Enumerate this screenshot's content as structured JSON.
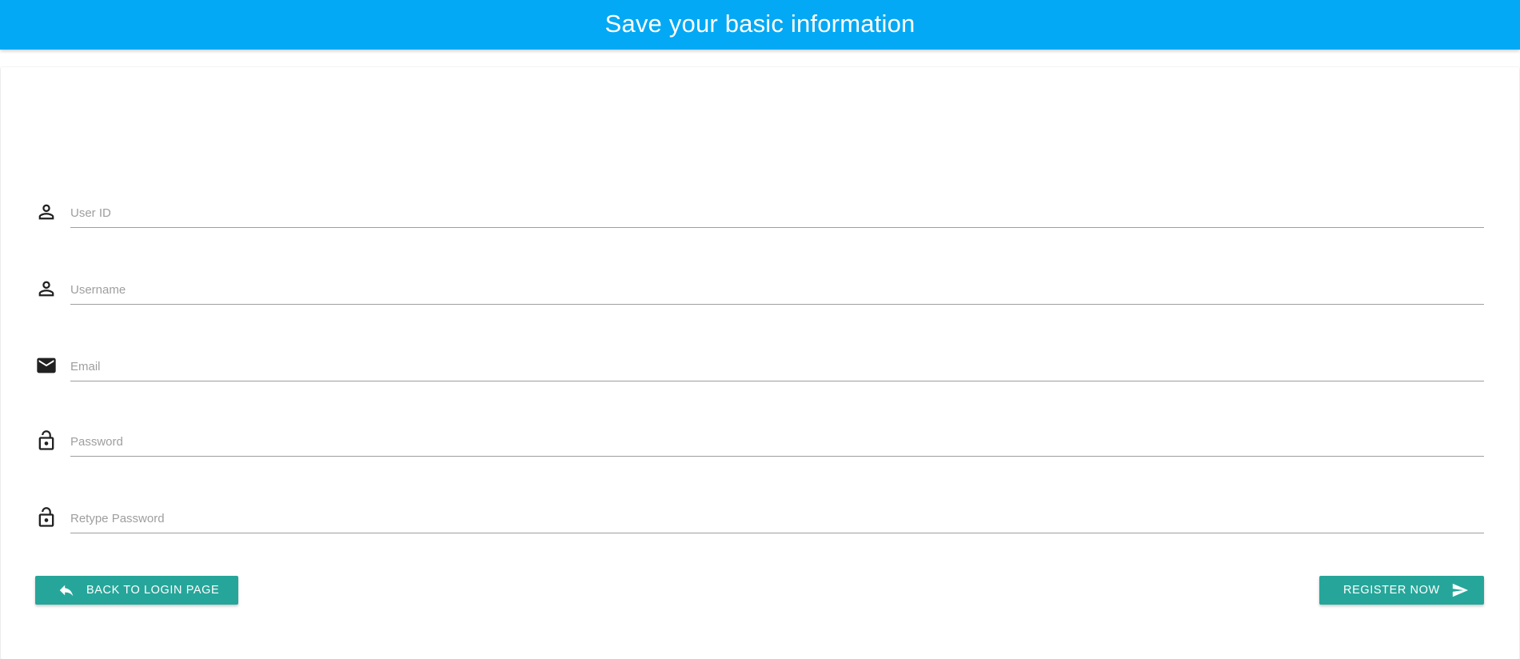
{
  "header": {
    "title": "Save your basic information",
    "color": "#03a9f4"
  },
  "form": {
    "fields": [
      {
        "icon": "person-icon",
        "placeholder": "User ID",
        "value": ""
      },
      {
        "icon": "person-icon",
        "placeholder": "Username",
        "value": ""
      },
      {
        "icon": "email-icon",
        "placeholder": "Email",
        "value": ""
      },
      {
        "icon": "lock-icon",
        "placeholder": "Password",
        "value": ""
      },
      {
        "icon": "lock-icon",
        "placeholder": "Retype Password",
        "value": ""
      }
    ]
  },
  "actions": {
    "back_label": "Back to login page",
    "back_icon": "reply-icon",
    "register_label": "Register now",
    "register_icon": "send-icon",
    "button_color": "#26a69a"
  }
}
